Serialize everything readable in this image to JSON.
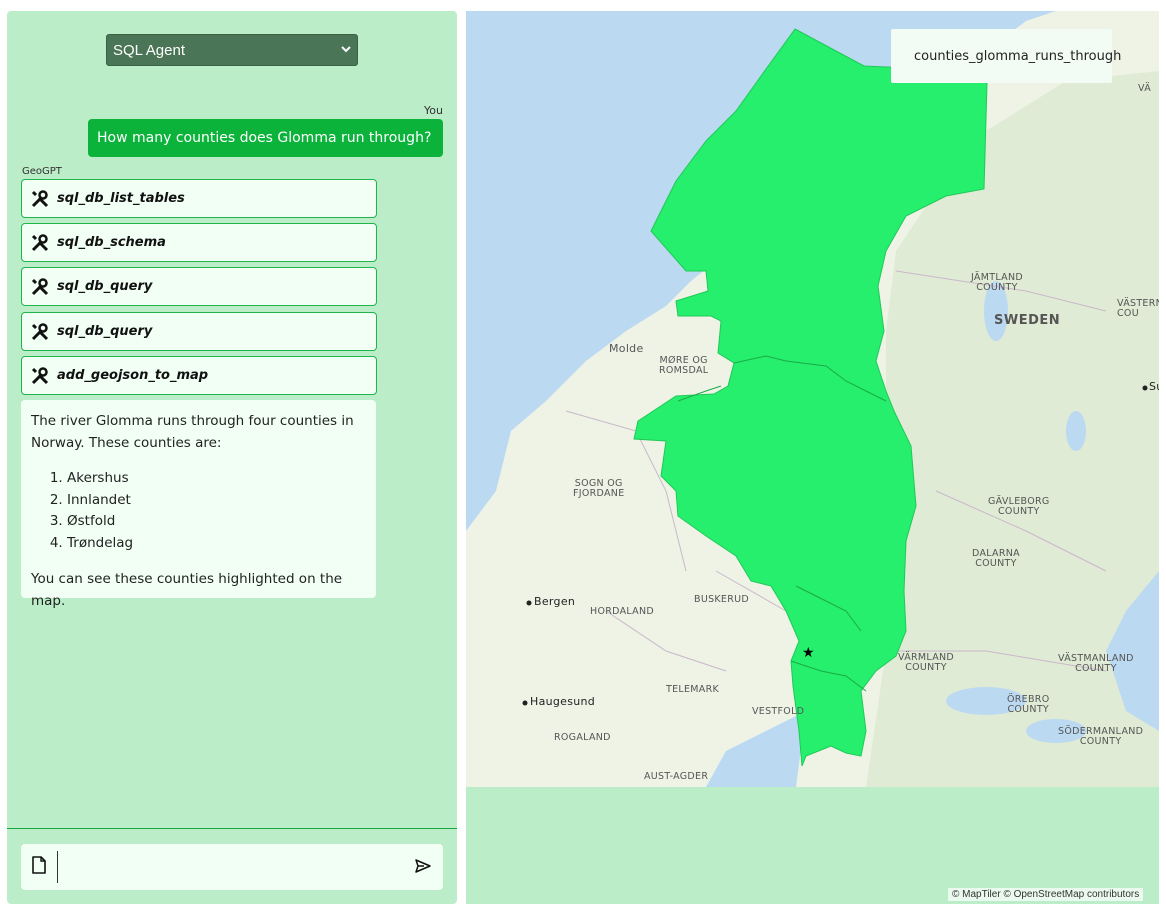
{
  "agent_selector": {
    "selected": "SQL Agent"
  },
  "chat": {
    "user_sender": "You",
    "user_message": "How many counties does Glomma run through?",
    "assistant_sender": "GeoGPT",
    "tool_calls": [
      {
        "label": "sql_db_list_tables",
        "icon": "wrench-screwdriver-icon"
      },
      {
        "label": "sql_db_schema",
        "icon": "wrench-screwdriver-icon"
      },
      {
        "label": "sql_db_query",
        "icon": "wrench-screwdriver-icon"
      },
      {
        "label": "sql_db_query",
        "icon": "wrench-screwdriver-icon"
      },
      {
        "label": "add_geojson_to_map",
        "icon": "wrench-screwdriver-icon"
      }
    ],
    "answer": {
      "intro": "The river Glomma runs through four counties in Norway. These counties are:",
      "items": [
        "Akershus",
        "Innlandet",
        "Østfold",
        "Trøndelag"
      ],
      "outro": "You can see these counties highlighted on the map."
    }
  },
  "composer": {
    "value": "",
    "attach_icon": "file-icon",
    "send_icon": "send-icon"
  },
  "map": {
    "layer_name": "counties_glomma_runs_through",
    "highlight_color": "#25ef6c",
    "water_color": "#bcd9f2",
    "land_color": "#eef3e6",
    "labels": {
      "sweden": "SWEDEN",
      "jamtland": "JÄMTLAND\nCOUNTY",
      "vasternorrland": "VÄSTERN\nCOU",
      "gavleborg": "GÄVLEBORG\nCOUNTY",
      "dalarna": "DALARNA\nCOUNTY",
      "varmland": "VÄRMLAND\nCOUNTY",
      "vastmanland": "VÄSTMANLAND\nCOUNTY",
      "orebro": "ÖREBRO\nCOUNTY",
      "sodermanland": "SÖDERMANLAND\nCOUNTY",
      "more_romsdal": "MØRE OG\nROMSDAL",
      "sogn_fjordane": "SOGN OG\nFJORDANE",
      "hordaland": "HORDALAND",
      "buskerud": "BUSKERUD",
      "telemark": "TELEMARK",
      "vestfold": "VESTFOLD",
      "rogaland": "ROGALAND",
      "aust_agder": "AUST-AGDER",
      "va": "VÄ",
      "molde": "Molde",
      "bergen": "Bergen",
      "haugesund": "Haugesund",
      "su": "Su"
    },
    "attribution": "© MapTiler © OpenStreetMap contributors"
  }
}
